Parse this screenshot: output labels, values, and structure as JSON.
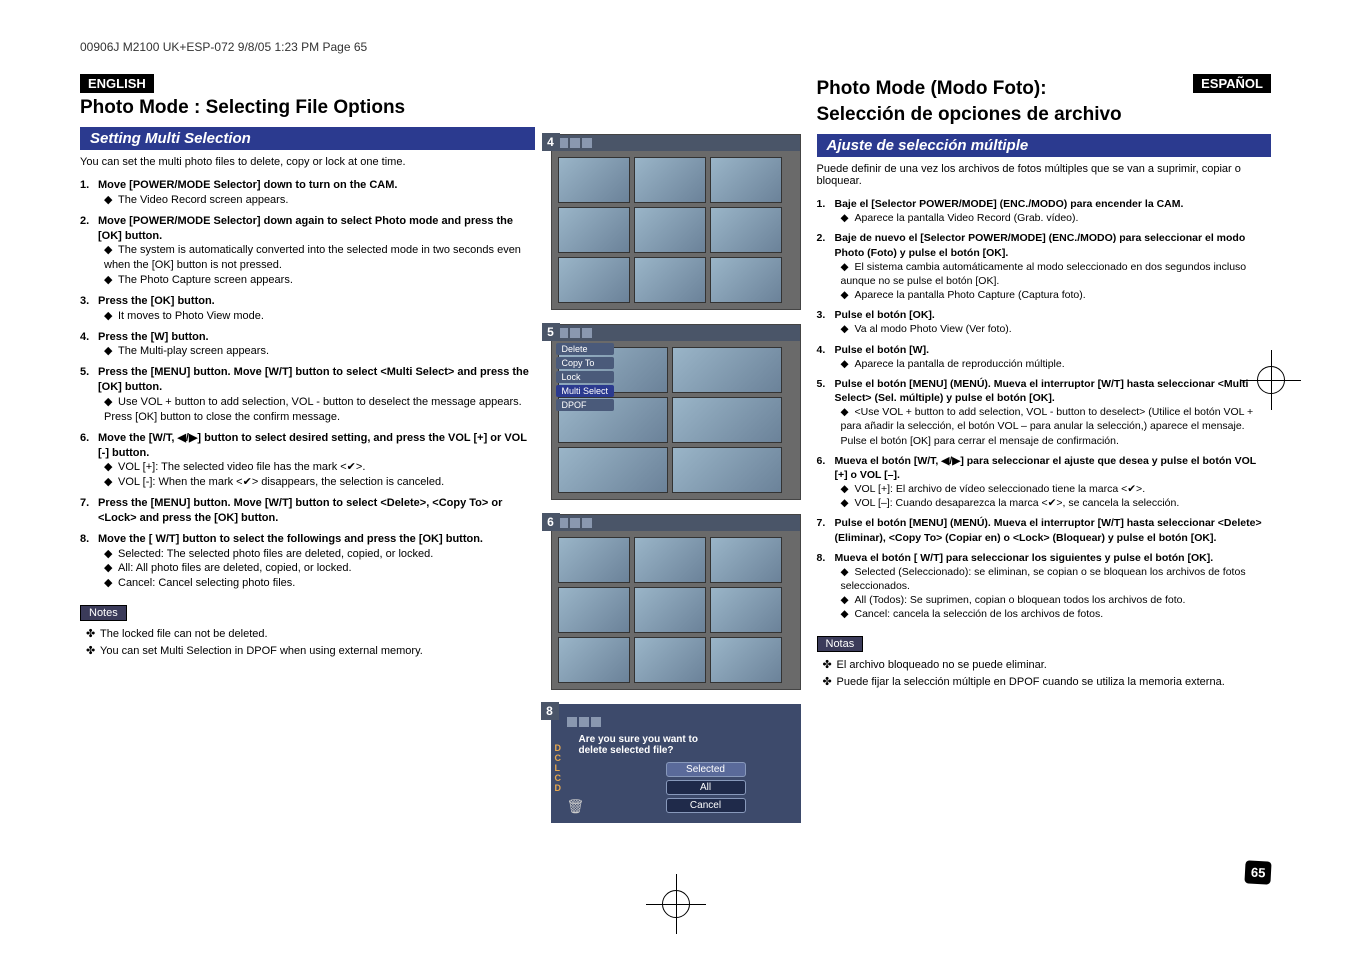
{
  "header_line": "00906J M2100 UK+ESP-072  9/8/05 1:23 PM  Page 65",
  "left": {
    "lang_tag": "ENGLISH",
    "section_title": "Photo Mode : Selecting File Options",
    "subtitle": "Setting Multi Selection",
    "intro": "You can set the multi photo files to delete, copy or lock at one time.",
    "steps": [
      {
        "num": "1.",
        "text": "Move [POWER/MODE Selector] down to turn on the CAM.",
        "bullets": [
          "The Video Record screen appears."
        ]
      },
      {
        "num": "2.",
        "text": "Move [POWER/MODE Selector] down again to select Photo mode and press the [OK] button.",
        "bullets": [
          "The system is automatically converted into the selected mode in two seconds even when the [OK] button is not pressed.",
          "The Photo Capture screen appears."
        ]
      },
      {
        "num": "3.",
        "text": "Press the [OK] button.",
        "bullets": [
          "It moves to Photo View mode."
        ]
      },
      {
        "num": "4.",
        "text": "Press the [W] button.",
        "bullets": [
          "The Multi-play screen appears."
        ]
      },
      {
        "num": "5.",
        "text": "Press the [MENU] button. Move [W/T] button to select <Multi Select> and press the [OK] button.",
        "bullets": [
          "Use VOL + button to add selection, VOL - button to deselect the message appears. Press [OK] button to close the confirm message."
        ]
      },
      {
        "num": "6.",
        "text": "Move the [W/T, ◀/▶] button to select desired setting, and press the VOL [+] or VOL [-] button.",
        "bullets": [
          "VOL [+]: The selected video file has the mark <✔>.",
          "VOL [-]: When the mark <✔> disappears, the selection is canceled."
        ]
      },
      {
        "num": "7.",
        "text": "Press the [MENU] button. Move [W/T] button to select <Delete>, <Copy To> or <Lock> and press the [OK] button.",
        "bullets": []
      },
      {
        "num": "8.",
        "text": "Move the [ W/T] button to select the followings and press the [OK] button.",
        "bullets": [
          "Selected: The selected photo files are deleted, copied, or locked.",
          "All: All photo files are deleted, copied, or locked.",
          "Cancel: Cancel selecting photo files."
        ]
      }
    ],
    "notes_label": "Notes",
    "notes": [
      "The locked file can not be deleted.",
      "You can set Multi Selection in DPOF when using external memory."
    ]
  },
  "right": {
    "lang_tag": "ESPAÑOL",
    "section_title_1": "Photo Mode (Modo Foto):",
    "section_title_2": "Selección de opciones de archivo",
    "subtitle": "Ajuste de selección múltiple",
    "intro": "Puede definir de una vez los archivos de fotos múltiples que se van a suprimir, copiar o bloquear.",
    "steps": [
      {
        "num": "1.",
        "text": "Baje el [Selector POWER/MODE] (ENC./MODO) para encender la CAM.",
        "bullets": [
          "Aparece la pantalla Video Record (Grab. vídeo)."
        ]
      },
      {
        "num": "2.",
        "text": "Baje de nuevo el [Selector POWER/MODE] (ENC./MODO) para seleccionar el modo Photo (Foto) y pulse el botón [OK].",
        "bullets": [
          "El sistema cambia automáticamente al modo seleccionado en dos segundos incluso aunque no se pulse el botón [OK].",
          "Aparece la pantalla Photo Capture (Captura foto)."
        ]
      },
      {
        "num": "3.",
        "text": "Pulse el botón [OK].",
        "bullets": [
          "Va al modo Photo View (Ver foto)."
        ]
      },
      {
        "num": "4.",
        "text": "Pulse el botón [W].",
        "bullets": [
          "Aparece la pantalla de reproducción múltiple."
        ]
      },
      {
        "num": "5.",
        "text": "Pulse el botón [MENU] (MENÚ). Mueva el interruptor [W/T] hasta seleccionar <Multi Select> (Sel. múltiple) y pulse el botón [OK].",
        "bullets": [
          "<Use VOL + button to add selection, VOL - button to deselect> (Utilice el botón VOL + para añadir la selección, el botón VOL – para anular la selección,) aparece el mensaje. Pulse el botón [OK] para cerrar el mensaje de confirmación."
        ]
      },
      {
        "num": "6.",
        "text": "Mueva el botón [W/T, ◀/▶] para seleccionar el ajuste que desea y pulse el botón VOL [+] o VOL [–].",
        "bullets": [
          "VOL [+]: El archivo de vídeo seleccionado tiene la marca <✔>.",
          "VOL [–]: Cuando desaparezca la marca <✔>, se cancela la selección."
        ]
      },
      {
        "num": "7.",
        "text": "Pulse el botón [MENU] (MENÚ). Mueva el interruptor [W/T] hasta seleccionar <Delete> (Eliminar), <Copy To> (Copiar en) o <Lock> (Bloquear) y pulse el botón [OK].",
        "bullets": []
      },
      {
        "num": "8.",
        "text": "Mueva el botón [ W/T] para seleccionar los siguientes y pulse el botón [OK].",
        "bullets": [
          "Selected (Seleccionado): se eliminan, se copian o se bloquean los archivos de fotos seleccionados.",
          "All (Todos): Se suprimen, copian o bloquean todos los archivos de foto.",
          "Cancel: cancela la selección de los archivos de fotos."
        ]
      }
    ],
    "notes_label": "Notas",
    "notes": [
      "El archivo bloqueado no se puede eliminar.",
      "Puede fijar la selección múltiple en DPOF cuando se utiliza la memoria externa."
    ]
  },
  "screens": {
    "s4": "4",
    "s5": "5",
    "s6": "6",
    "s8": "8",
    "menu_items": [
      "Delete",
      "Copy To",
      "Lock",
      "Multi Select",
      "DPOF"
    ],
    "dialog_question_l1": "Are you sure you want to",
    "dialog_question_l2": "delete selected file?",
    "dialog_buttons": [
      "Selected",
      "All",
      "Cancel"
    ],
    "side_letters_top": [
      "D",
      "C",
      "L",
      "C",
      "D"
    ]
  },
  "page_number": "65"
}
